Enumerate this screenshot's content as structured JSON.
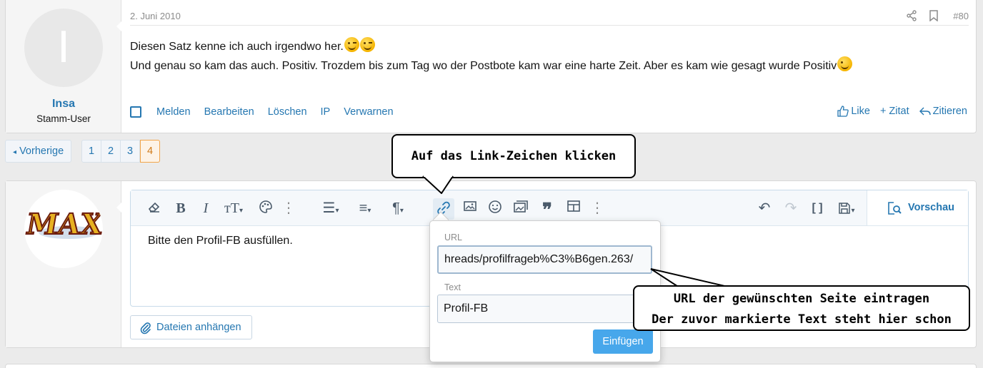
{
  "post1": {
    "date": "2. Juni 2010",
    "number": "#80",
    "avatar_letter": "I",
    "username": "Insa",
    "user_title": "Stamm-User",
    "line1": "Diesen Satz kenne ich auch irgendwo her.",
    "line2": "Und genau so kam das auch. Positiv. Trozdem bis zum Tag wo der Postbote kam war eine harte Zeit. Aber es kam wie gesagt wurde Positiv",
    "actions": [
      "Melden",
      "Bearbeiten",
      "Löschen",
      "IP",
      "Verwarnen"
    ],
    "like": "Like",
    "quote": "+ Zitat",
    "cite": "Zitieren"
  },
  "pagination": {
    "prev": "Vorherige",
    "pages": [
      "1",
      "2",
      "3",
      "4"
    ],
    "current": "4"
  },
  "editor": {
    "logo_text": "MAX",
    "body_text": "Bitte den Profil-FB ausfüllen.",
    "preview": "Vorschau",
    "attach": "Dateien anhängen"
  },
  "link_popup": {
    "url_label": "URL",
    "url_value": "hreads/profilfrageb%C3%B6gen.263/",
    "text_label": "Text",
    "text_value": "Profil-FB",
    "insert": "Einfügen"
  },
  "callouts": {
    "top": "Auf das Link-Zeichen klicken",
    "right_line1": "URL der gewünschten Seite eintragen",
    "right_line2": "Der zuvor markierte Text steht hier schon"
  }
}
